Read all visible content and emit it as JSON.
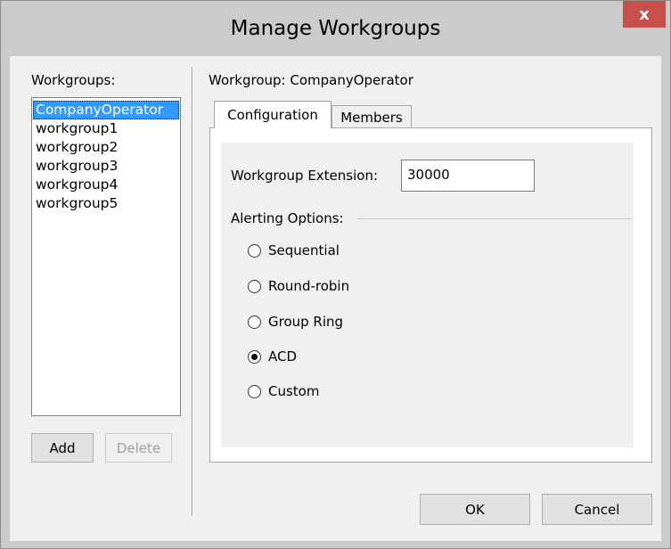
{
  "dialog": {
    "title": "Manage Workgroups",
    "close_glyph": "x"
  },
  "left_panel": {
    "label": "Workgroups:",
    "items": [
      "CompanyOperator",
      "workgroup1",
      "workgroup2",
      "workgroup3",
      "workgroup4",
      "workgroup5"
    ],
    "selected_index": 0,
    "add_label": "Add",
    "delete_label": "Delete"
  },
  "right_panel": {
    "header": "Workgroup: CompanyOperator",
    "tabs": [
      {
        "label": "Configuration",
        "active": true
      },
      {
        "label": "Members",
        "active": false
      }
    ],
    "extension_label": "Workgroup Extension:",
    "extension_value": "30000",
    "alerting_label": "Alerting Options:",
    "alerting_options": [
      {
        "label": "Sequential",
        "checked": false
      },
      {
        "label": "Round-robin",
        "checked": false
      },
      {
        "label": "Group Ring",
        "checked": false
      },
      {
        "label": "ACD",
        "checked": true
      },
      {
        "label": "Custom",
        "checked": false
      }
    ]
  },
  "footer": {
    "ok_label": "OK",
    "cancel_label": "Cancel"
  },
  "colors": {
    "selection": "#3399ff",
    "close_button": "#c7504a",
    "frame": "#cbcbcb"
  }
}
